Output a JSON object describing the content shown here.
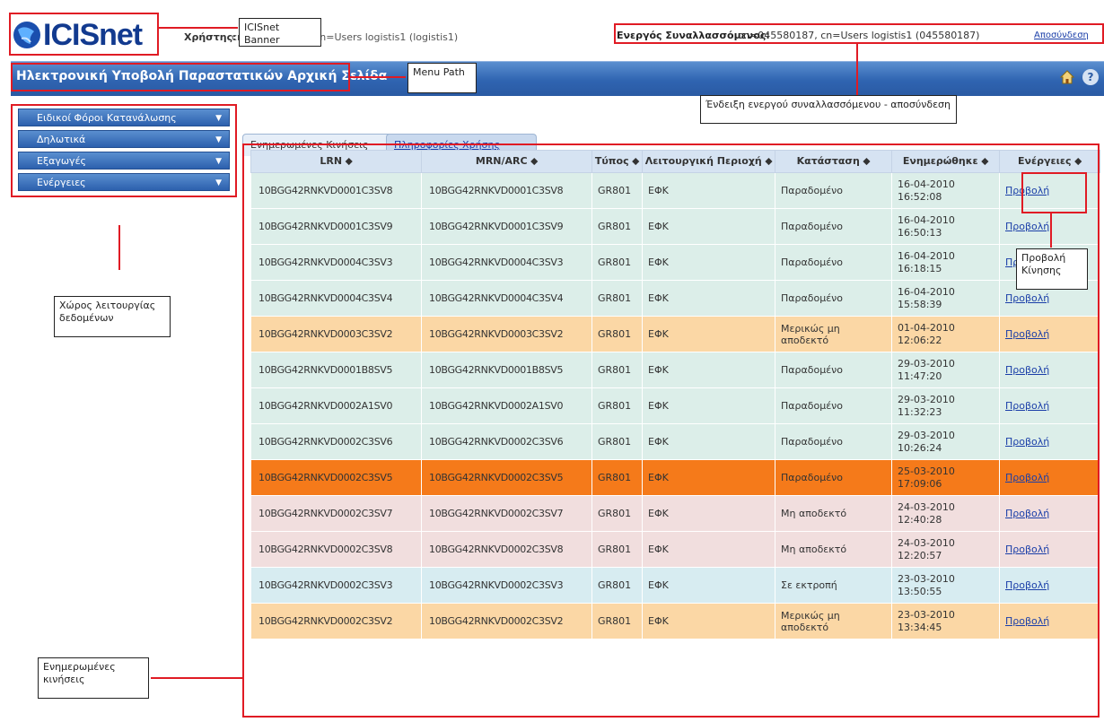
{
  "banner": {
    "logo_text": "ICISnet",
    "user_label": "Χρήστης:",
    "user_value": "cn=045580187, cn=Users logistis1 (logistis1)",
    "trader_label": "Ενεργός Συναλλασσόμενος:",
    "trader_value": "cn=045580187, cn=Users logistis1 (045580187)",
    "logout": "Αποσύνδεση"
  },
  "menu": {
    "path": "Ηλεκτρονική Υποβολή Παραστατικών Αρχική Σελίδα"
  },
  "sidebar": {
    "items": [
      {
        "label": "Ειδικοί Φόροι Κατανάλωσης"
      },
      {
        "label": "Δηλωτικά"
      },
      {
        "label": "Εξαγωγές"
      },
      {
        "label": "Ενέργειες"
      }
    ]
  },
  "tabs": [
    {
      "label": "Ενημερωμένες Κινήσεις"
    },
    {
      "label": "Πληροφορίες Χρήσης"
    }
  ],
  "table": {
    "headers": [
      "LRN ⬥",
      "MRN/ARC ⬥",
      "Τύπος ⬥",
      "Λειτουργική Περιοχή ⬥",
      "Κατάσταση ⬥",
      "Ενημερώθηκε ⬥",
      "Ενέργειες ⬥"
    ],
    "rows": [
      {
        "lrn": "10BGG42RNKVD0001C3SV8",
        "mrn": "10BGG42RNKVD0001C3SV8",
        "type": "GR801",
        "area": "ΕΦΚ",
        "status": "Παραδομένο",
        "date": "16-04-2010",
        "time": "16:52:08",
        "action": "Προβολή",
        "style": "green"
      },
      {
        "lrn": "10BGG42RNKVD0001C3SV9",
        "mrn": "10BGG42RNKVD0001C3SV9",
        "type": "GR801",
        "area": "ΕΦΚ",
        "status": "Παραδομένο",
        "date": "16-04-2010",
        "time": "16:50:13",
        "action": "Προβολή",
        "style": "green"
      },
      {
        "lrn": "10BGG42RNKVD0004C3SV3",
        "mrn": "10BGG42RNKVD0004C3SV3",
        "type": "GR801",
        "area": "ΕΦΚ",
        "status": "Παραδομένο",
        "date": "16-04-2010",
        "time": "16:18:15",
        "action": "Προβολή",
        "style": "green"
      },
      {
        "lrn": "10BGG42RNKVD0004C3SV4",
        "mrn": "10BGG42RNKVD0004C3SV4",
        "type": "GR801",
        "area": "ΕΦΚ",
        "status": "Παραδομένο",
        "date": "16-04-2010",
        "time": "15:58:39",
        "action": "Προβολή",
        "style": "green"
      },
      {
        "lrn": "10BGG42RNKVD0003C3SV2",
        "mrn": "10BGG42RNKVD0003C3SV2",
        "type": "GR801",
        "area": "ΕΦΚ",
        "status": "Μερικώς μη αποδεκτό",
        "date": "01-04-2010",
        "time": "12:06:22",
        "action": "Προβολή",
        "style": "peach"
      },
      {
        "lrn": "10BGG42RNKVD0001B8SV5",
        "mrn": "10BGG42RNKVD0001B8SV5",
        "type": "GR801",
        "area": "ΕΦΚ",
        "status": "Παραδομένο",
        "date": "29-03-2010",
        "time": "11:47:20",
        "action": "Προβολή",
        "style": "green"
      },
      {
        "lrn": "10BGG42RNKVD0002A1SV0",
        "mrn": "10BGG42RNKVD0002A1SV0",
        "type": "GR801",
        "area": "ΕΦΚ",
        "status": "Παραδομένο",
        "date": "29-03-2010",
        "time": "11:32:23",
        "action": "Προβολή",
        "style": "green"
      },
      {
        "lrn": "10BGG42RNKVD0002C3SV6",
        "mrn": "10BGG42RNKVD0002C3SV6",
        "type": "GR801",
        "area": "ΕΦΚ",
        "status": "Παραδομένο",
        "date": "29-03-2010",
        "time": "10:26:24",
        "action": "Προβολή",
        "style": "green"
      },
      {
        "lrn": "10BGG42RNKVD0002C3SV5",
        "mrn": "10BGG42RNKVD0002C3SV5",
        "type": "GR801",
        "area": "ΕΦΚ",
        "status": "Παραδομένο",
        "date": "25-03-2010",
        "time": "17:09:06",
        "action": "Προβολή",
        "style": "orange"
      },
      {
        "lrn": "10BGG42RNKVD0002C3SV7",
        "mrn": "10BGG42RNKVD0002C3SV7",
        "type": "GR801",
        "area": "ΕΦΚ",
        "status": "Μη αποδεκτό",
        "date": "24-03-2010",
        "time": "12:40:28",
        "action": "Προβολή",
        "style": "pink"
      },
      {
        "lrn": "10BGG42RNKVD0002C3SV8",
        "mrn": "10BGG42RNKVD0002C3SV8",
        "type": "GR801",
        "area": "ΕΦΚ",
        "status": "Μη αποδεκτό",
        "date": "24-03-2010",
        "time": "12:20:57",
        "action": "Προβολή",
        "style": "pink"
      },
      {
        "lrn": "10BGG42RNKVD0002C3SV3",
        "mrn": "10BGG42RNKVD0002C3SV3",
        "type": "GR801",
        "area": "ΕΦΚ",
        "status": "Σε εκτροπή",
        "date": "23-03-2010",
        "time": "13:50:55",
        "action": "Προβολή",
        "style": "blue"
      },
      {
        "lrn": "10BGG42RNKVD0002C3SV2",
        "mrn": "10BGG42RNKVD0002C3SV2",
        "type": "GR801",
        "area": "ΕΦΚ",
        "status": "Μερικώς μη αποδεκτό",
        "date": "23-03-2010",
        "time": "13:34:45",
        "action": "Προβολή",
        "style": "peach"
      }
    ]
  },
  "annotations": {
    "banner": "ICISnet Banner",
    "menu_path": "Menu Path",
    "active_trader": "Ένδειξη ενεργού συναλλασσόμενου - αποσύνδεση",
    "function_area": "Χώρος λειτουργίας δεδομένων",
    "view_movement": "Προβολή Κίνησης",
    "updated_movements": "Ενημερωμένες κινήσεις"
  },
  "colors": {
    "accent": "#2f64b1",
    "annotation": "#e01b24",
    "highlight_row": "#f57a1a"
  }
}
